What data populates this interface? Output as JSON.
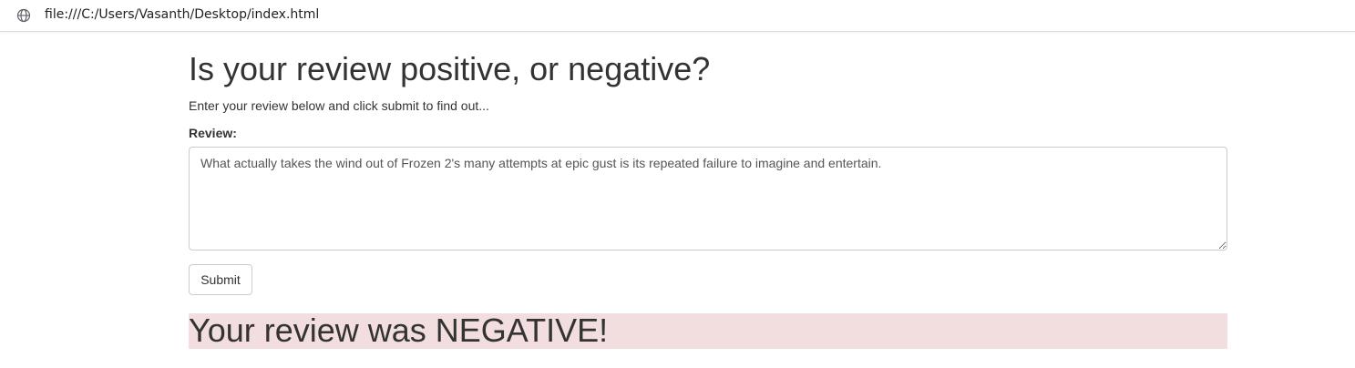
{
  "browser": {
    "url": "file:///C:/Users/Vasanth/Desktop/index.html",
    "address_icon": "globe-icon"
  },
  "main": {
    "title": "Is your review positive, or negative?",
    "subtitle": "Enter your review below and click submit to find out...",
    "review_label": "Review:",
    "review_value": "What actually takes the wind out of Frozen 2's many attempts at epic gust is its repeated failure to imagine and entertain.",
    "submit_label": "Submit",
    "result_text": "Your review was NEGATIVE!",
    "result_color": "#f2dede"
  }
}
